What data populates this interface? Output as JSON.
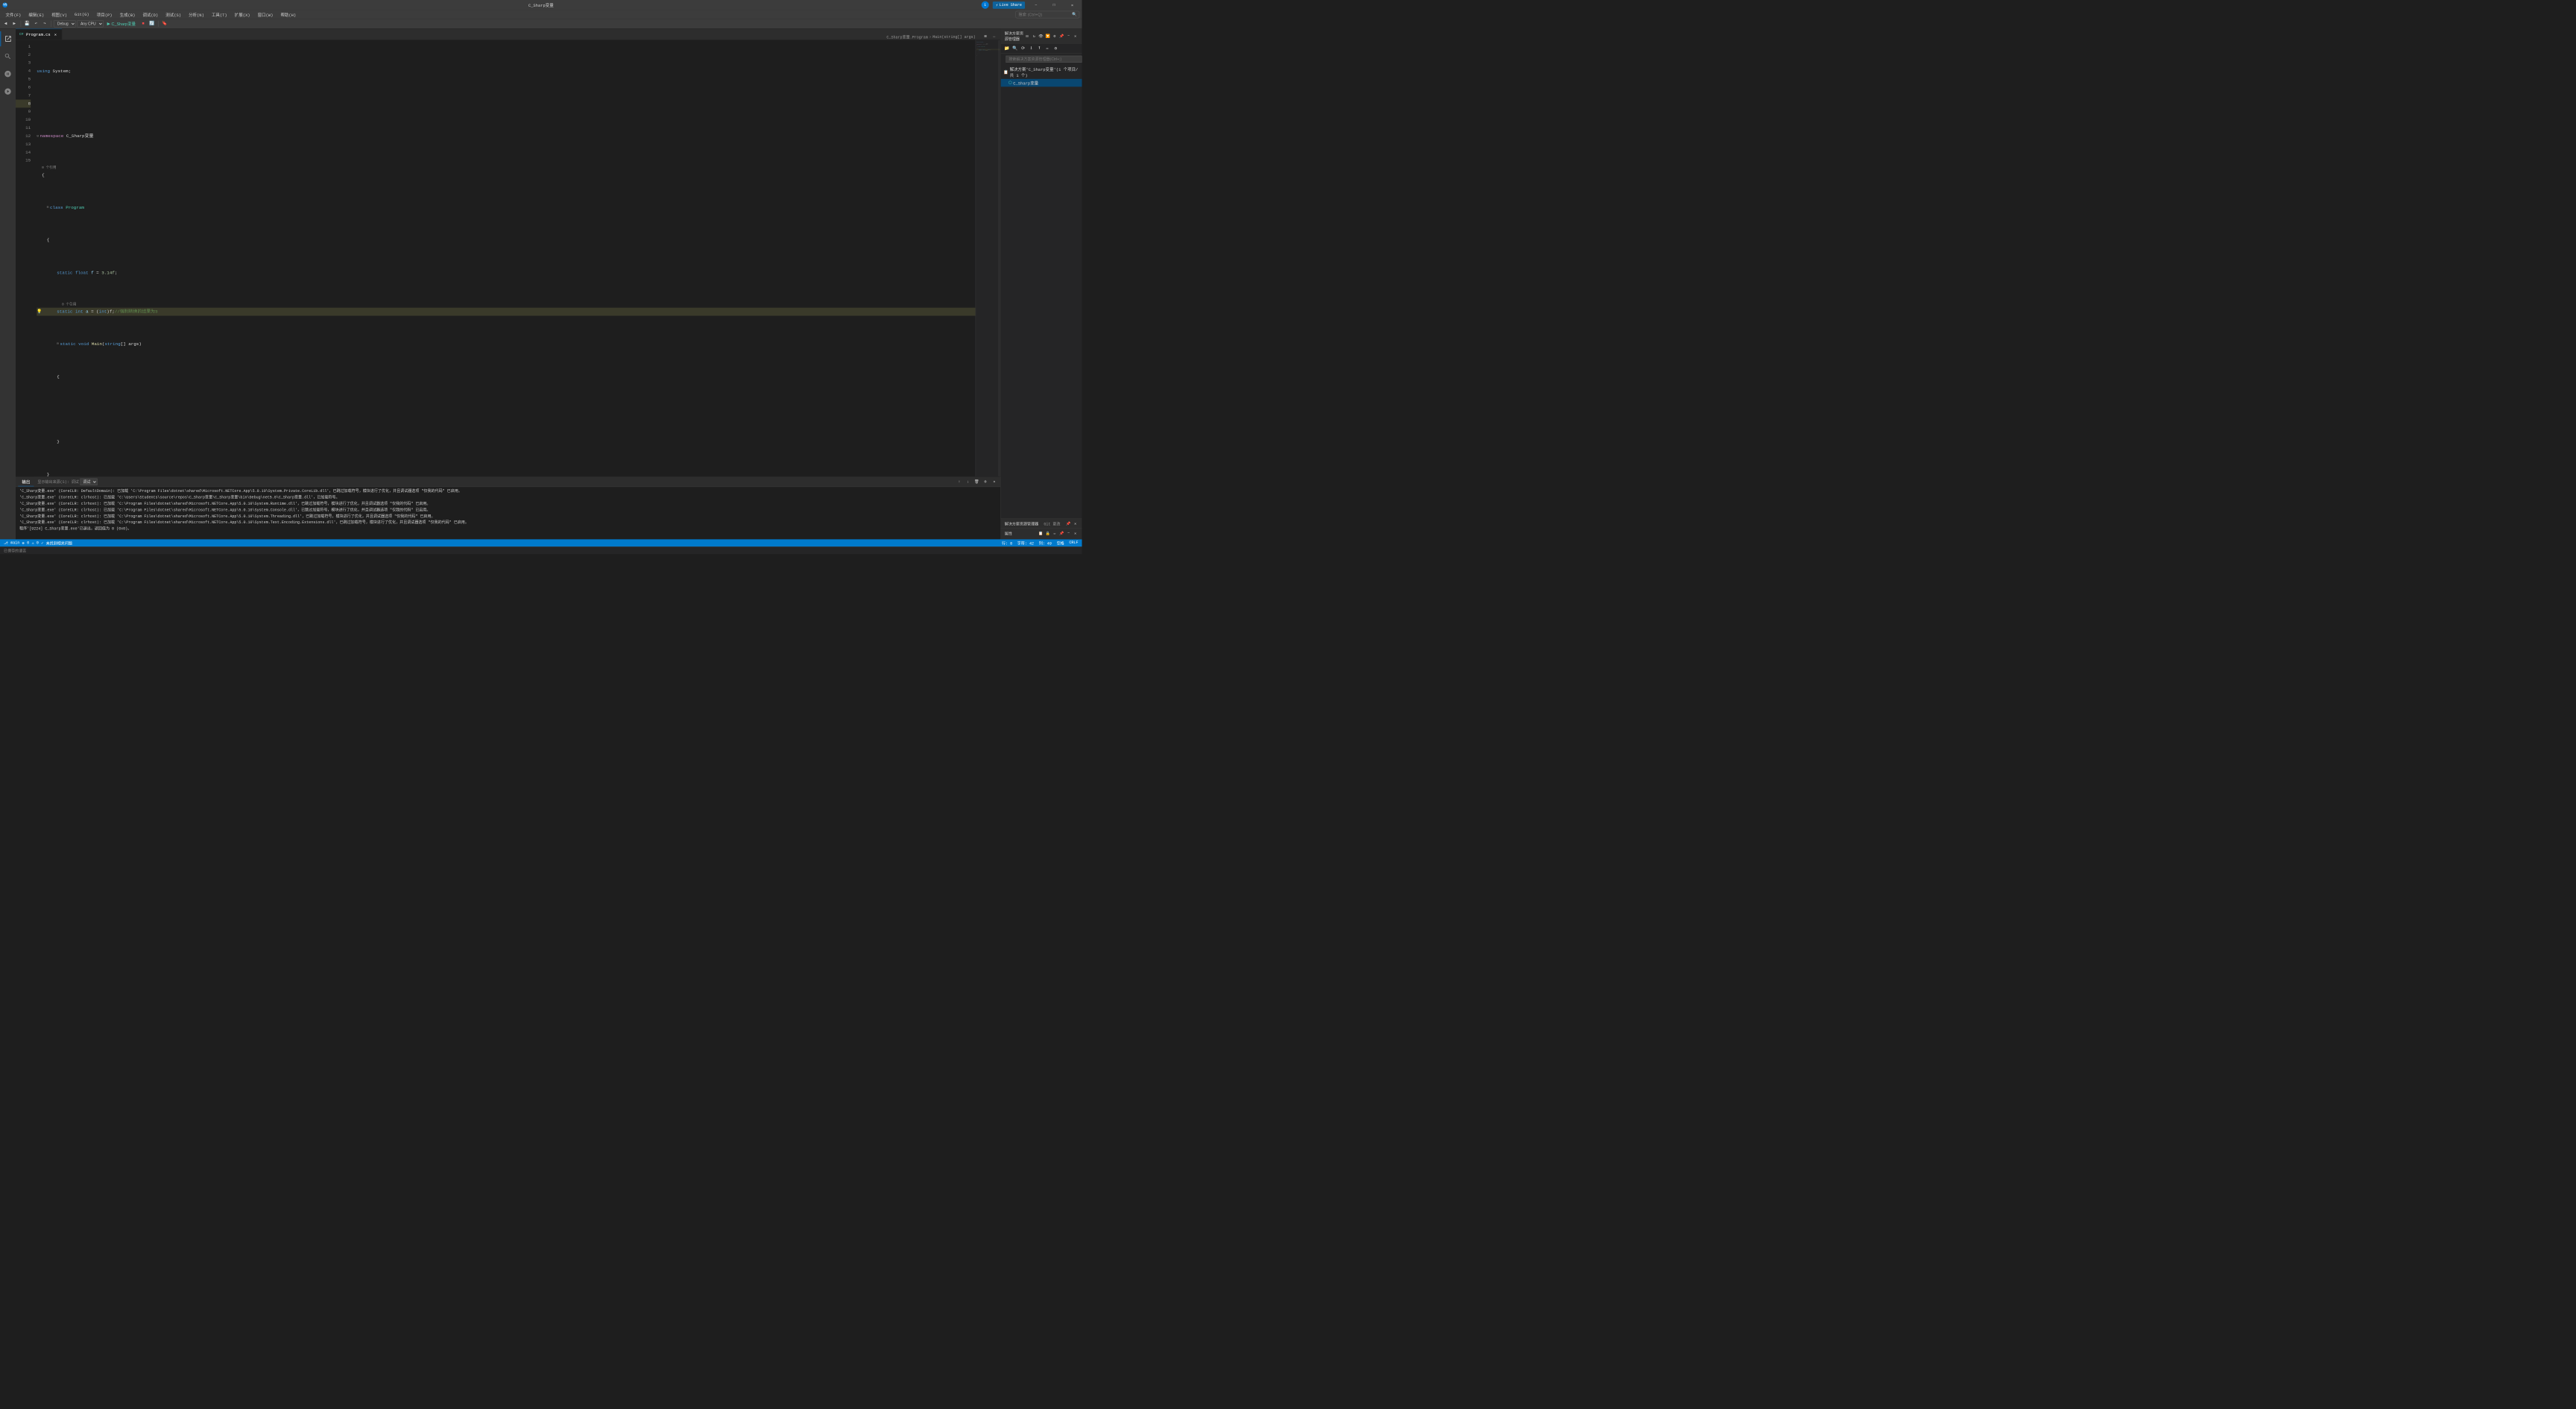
{
  "titleBar": {
    "title": "C_Sharp变量",
    "appIcon": "VS",
    "userIcon": "1",
    "liveShareLabel": "Live Share",
    "windowButtons": {
      "minimize": "−",
      "maximize": "□",
      "close": "✕"
    }
  },
  "menuBar": {
    "items": [
      {
        "label": "文件(F)"
      },
      {
        "label": "编辑(E)"
      },
      {
        "label": "视图(V)"
      },
      {
        "label": "Git(G)"
      },
      {
        "label": "项目(P)"
      },
      {
        "label": "生成(B)"
      },
      {
        "label": "调试(D)"
      },
      {
        "label": "测试(S)"
      },
      {
        "label": "分析(N)"
      },
      {
        "label": "工具(T)"
      },
      {
        "label": "扩展(X)"
      },
      {
        "label": "窗口(W)"
      },
      {
        "label": "帮助(H)"
      }
    ],
    "searchPlaceholder": "搜索 (Ctrl+Q)"
  },
  "toolbar": {
    "debugMode": "Debug",
    "platform": "Any CPU",
    "project": "C_Sharp变量",
    "playLabel": "▶ C_Sharp变量"
  },
  "tabs": {
    "active": "Program.cs",
    "items": [
      {
        "label": "Program.cs",
        "active": true,
        "modified": false
      },
      {
        "label": "C_Sharp变量.Program",
        "active": false
      },
      {
        "label": "Main(string[] args)",
        "active": false
      }
    ]
  },
  "breadcrumb": {
    "parts": [
      "C_Sharp变量",
      "Program"
    ]
  },
  "code": {
    "lines": [
      {
        "num": 1,
        "content": "using System;",
        "tokens": [
          {
            "text": "using",
            "class": "kw"
          },
          {
            "text": " System",
            "class": ""
          },
          {
            "text": ";",
            "class": "op"
          }
        ]
      },
      {
        "num": 2,
        "content": "",
        "tokens": []
      },
      {
        "num": 3,
        "content": "namespace C_Sharp变量",
        "tokens": [
          {
            "text": "namespace",
            "class": "kw2"
          },
          {
            "text": " C_Sharp变量",
            "class": ""
          }
        ],
        "collapsible": true
      },
      {
        "num": 4,
        "content": "{",
        "tokens": [
          {
            "text": "{",
            "class": "op"
          }
        ],
        "refCount": "0 个引用"
      },
      {
        "num": 5,
        "content": "    class Program",
        "tokens": [
          {
            "text": "    class",
            "class": "kw"
          },
          {
            "text": " Program",
            "class": "type"
          }
        ],
        "collapsible": true,
        "indent": 1
      },
      {
        "num": 6,
        "content": "    {",
        "tokens": [
          {
            "text": "    {",
            "class": "op"
          }
        ],
        "indent": 1
      },
      {
        "num": 7,
        "content": "        static float f = 3.14f;",
        "tokens": [
          {
            "text": "        static",
            "class": "kw"
          },
          {
            "text": " float",
            "class": "kw"
          },
          {
            "text": " f",
            "class": "var"
          },
          {
            "text": " = ",
            "class": "op"
          },
          {
            "text": "3.14f",
            "class": "num"
          },
          {
            "text": ";",
            "class": "op"
          }
        ],
        "indent": 2
      },
      {
        "num": 8,
        "content": "        static int a = (int)f;//强制转换的结果为3",
        "tokens": [
          {
            "text": "        static",
            "class": "kw"
          },
          {
            "text": " int",
            "class": "kw"
          },
          {
            "text": " a",
            "class": "var"
          },
          {
            "text": " = ",
            "class": "op"
          },
          {
            "text": "(",
            "class": "op"
          },
          {
            "text": "int",
            "class": "kw"
          },
          {
            "text": ")f;",
            "class": "op"
          },
          {
            "text": "//强制转换的结果为3",
            "class": "cmt"
          }
        ],
        "highlighted": true,
        "lightbulb": true,
        "refCount": "0 个引用",
        "indent": 2
      },
      {
        "num": 9,
        "content": "        static void Main(string[] args)",
        "tokens": [
          {
            "text": "        static",
            "class": "kw"
          },
          {
            "text": " void",
            "class": "kw"
          },
          {
            "text": " Main",
            "class": "fn"
          },
          {
            "text": "(",
            "class": "op"
          },
          {
            "text": "string",
            "class": "kw"
          },
          {
            "text": "[] args)",
            "class": "op"
          }
        ],
        "collapsible": true,
        "indent": 2
      },
      {
        "num": 10,
        "content": "        {",
        "tokens": [
          {
            "text": "        {",
            "class": "op"
          }
        ],
        "indent": 2
      },
      {
        "num": 11,
        "content": "",
        "tokens": [],
        "indent": 3
      },
      {
        "num": 12,
        "content": "        }",
        "tokens": [
          {
            "text": "        }",
            "class": "op"
          }
        ],
        "indent": 2
      },
      {
        "num": 13,
        "content": "    }",
        "tokens": [
          {
            "text": "    }",
            "class": "op"
          }
        ],
        "indent": 1
      },
      {
        "num": 14,
        "content": "}",
        "tokens": [
          {
            "text": "}",
            "class": "op"
          }
        ]
      },
      {
        "num": 15,
        "content": "",
        "tokens": []
      }
    ]
  },
  "solutionExplorer": {
    "title": "解决方案资源管理器",
    "searchPlaceholder": "搜索解决方案资源管理器(Ctrl+;)",
    "solutionLabel": "解决方案'C_Sharp变量'(1 个项目/共 1 个)",
    "projectLabel": "C_Sharp变量",
    "gitLabel": "Git 更改",
    "propertiesLabel": "属性"
  },
  "statusBar": {
    "branch": "main",
    "errors": "0",
    "warnings": "0",
    "statusText": "未找到相关问题",
    "line": "行: 8",
    "col": "字符: 42",
    "pos": "列: 49",
    "space": "空格",
    "encoding": "CRLF"
  },
  "outputPanel": {
    "tabs": [
      {
        "label": "输出",
        "active": true
      },
      {
        "label": "显示输出来源(S): 调试",
        "active": false
      }
    ],
    "lines": [
      "'C_Sharp变量.exe' (CoreCLR: DefaultDomain): 已加载 'C:\\Program Files\\dotnet\\shared\\Microsoft.NETCore.App\\5.0.10\\System.Private.CoreLib.dll'，已跳过加载符号，模块进行了优化，并且调试器选项 \"仅我的代码\" 已启用。",
      "'C_Sharp变量.exe' (CoreCLR: clrhost): 已加载 'C:\\Users\\Students\\source\\repos\\C_Sharp变量\\C_Sharp变量\\bin\\Debug\\net5.0\\C_Sharp变量.dll'，已加载符号。",
      "'C_Sharp变量.exe' (CoreCLR: clrhost): 已加载 'C:\\Program Files\\dotnet\\shared\\Microsoft.NETCore.App\\5.0.10\\System.Runtime.dll'，已跳过加载符号，模块进行了优化，并且调试器选项 \"仅我的代码\" 已启用。",
      "'C_Sharp变量.exe' (CoreCLR: clrhost): 已加载 'C:\\Program Files\\dotnet\\shared\\Microsoft.NETCore.App\\5.0.10\\System.Console.dll'，已跳过加载符号，模块进行了优化，并且调试器选项 \"仅我的代码\" 已启用。",
      "'C_Sharp变量.exe' (CoreCLR: clrhost): 已加载 'C:\\Program Files\\dotnet\\shared\\Microsoft.NETCore.App\\5.0.10\\System.Threading.dll'，已跳过加载符号，模块进行了优化，并且调试器选项 \"仅我的代码\" 已启用。",
      "'C_Sharp变量.exe' (CoreCLR: clrhost): 已加载 'C:\\Program Files\\dotnet\\shared\\Microsoft.NETCore.App\\5.0.10\\System.Text.Encoding.Extensions.dll'，已跳过加载符号，模块进行了优化，并且调试器选项 \"仅我的代码\" 已启用。",
      "程序'[9224] C_Sharp变量.exe'已退出，返回值为 0 (0x0)。"
    ]
  },
  "bottomBar": {
    "label": "已保存的语言"
  },
  "colors": {
    "accent": "#0078d4",
    "statusBarBg": "#007acc",
    "activeLineBg": "#3a3a2a",
    "titleBarBg": "#3c3c3c",
    "editorBg": "#1e1e1e",
    "sidebarBg": "#252526"
  }
}
